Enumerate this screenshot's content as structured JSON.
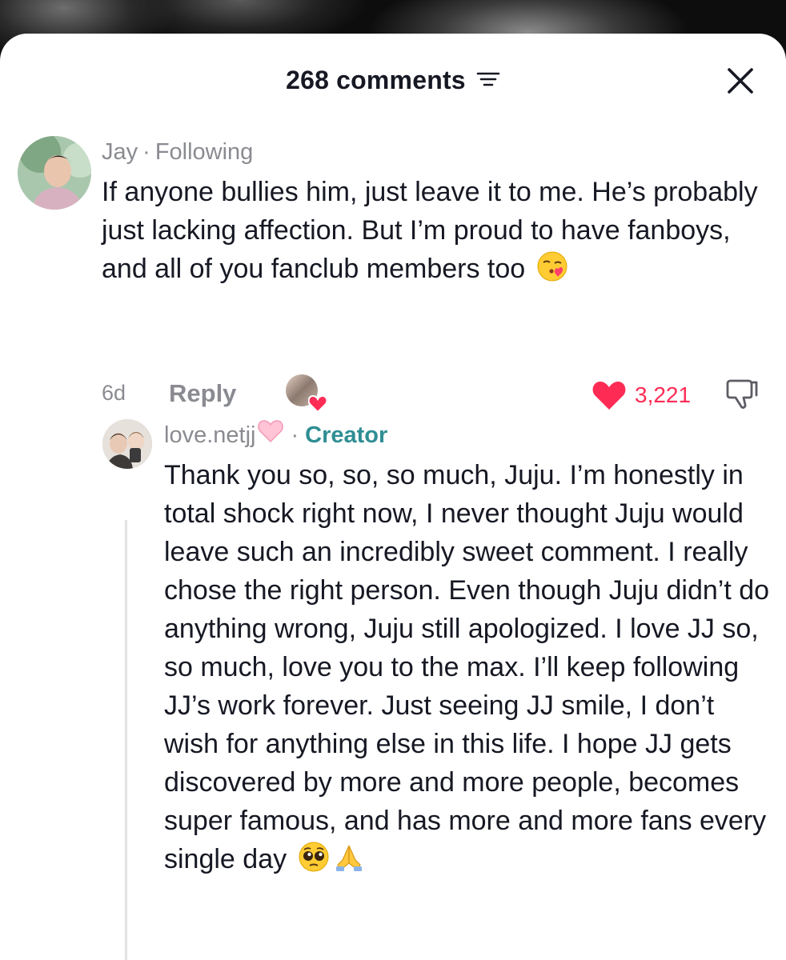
{
  "header": {
    "title": "268 comments"
  },
  "comment": {
    "username": "Jay",
    "relation": "Following",
    "separator": "·",
    "text": "If anyone bullies him, just leave it to me. He’s probably just lacking affection. But I’m proud to have fanboys, and all of you fanclub members too",
    "emoji": "kissing-face-with-heart-emoji",
    "time": "6d",
    "reply_label": "Reply",
    "like_count": "3,221",
    "liked": true,
    "like_color": "#fe2c55"
  },
  "reply": {
    "username": "love.netjj",
    "username_emoji": "pink-heart-emoji",
    "separator": "·",
    "badge": "Creator",
    "badge_color": "#2f8e94",
    "text": "Thank you so, so, so much, Juju. I’m honestly in total shock right now, I never thought Juju would leave such an incredibly sweet comment. I really chose the right person. Even though Juju didn’t do anything wrong, Juju still apologized. I love JJ so, so much, love you to the max. I’ll keep following JJ’s work forever. Just seeing JJ smile, I don’t wish for anything else in this life. I hope JJ gets discovered by more and more people, becomes super famous, and has more and more fans every single day",
    "emojis": [
      "pleading-face-emoji",
      "folded-hands-emoji"
    ]
  }
}
